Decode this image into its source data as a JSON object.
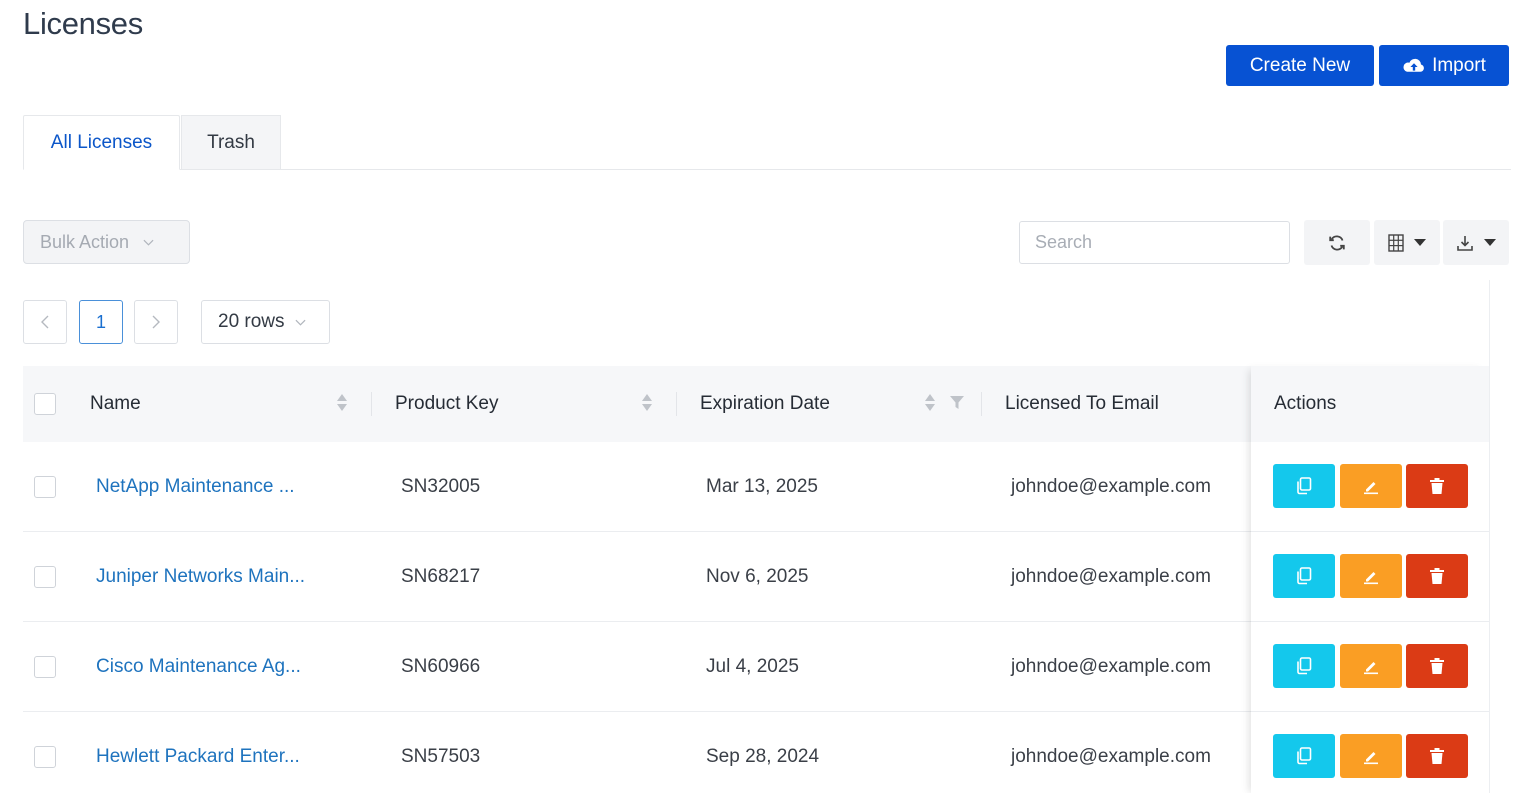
{
  "page": {
    "title": "Licenses"
  },
  "header_actions": {
    "create_label": "Create New",
    "import_label": "Import"
  },
  "tabs": [
    {
      "label": "All Licenses",
      "active": true
    },
    {
      "label": "Trash",
      "active": false
    }
  ],
  "toolbar": {
    "bulk_action_label": "Bulk Action",
    "search_placeholder": "Search",
    "icons": [
      "refresh-icon",
      "columns-icon",
      "download-icon"
    ]
  },
  "pagination": {
    "current_page": "1",
    "rows_label": "20 rows"
  },
  "table": {
    "columns": [
      "Name",
      "Product Key",
      "Expiration Date",
      "Licensed To Email",
      "Actions"
    ],
    "rows": [
      {
        "name": "NetApp Maintenance ...",
        "product_key": "SN32005",
        "expiration": "Mar 13, 2025",
        "email": "johndoe@example.com"
      },
      {
        "name": "Juniper Networks Main...",
        "product_key": "SN68217",
        "expiration": "Nov 6, 2025",
        "email": "johndoe@example.com"
      },
      {
        "name": "Cisco Maintenance Ag...",
        "product_key": "SN60966",
        "expiration": "Jul 4, 2025",
        "email": "johndoe@example.com"
      },
      {
        "name": "Hewlett Packard Enter...",
        "product_key": "SN57503",
        "expiration": "Sep 28, 2024",
        "email": "johndoe@example.com"
      }
    ]
  },
  "colors": {
    "primary": "#0752d3",
    "copy": "#14c8ec",
    "edit": "#fa9e24",
    "delete": "#db3b15",
    "link": "#1e73be"
  }
}
